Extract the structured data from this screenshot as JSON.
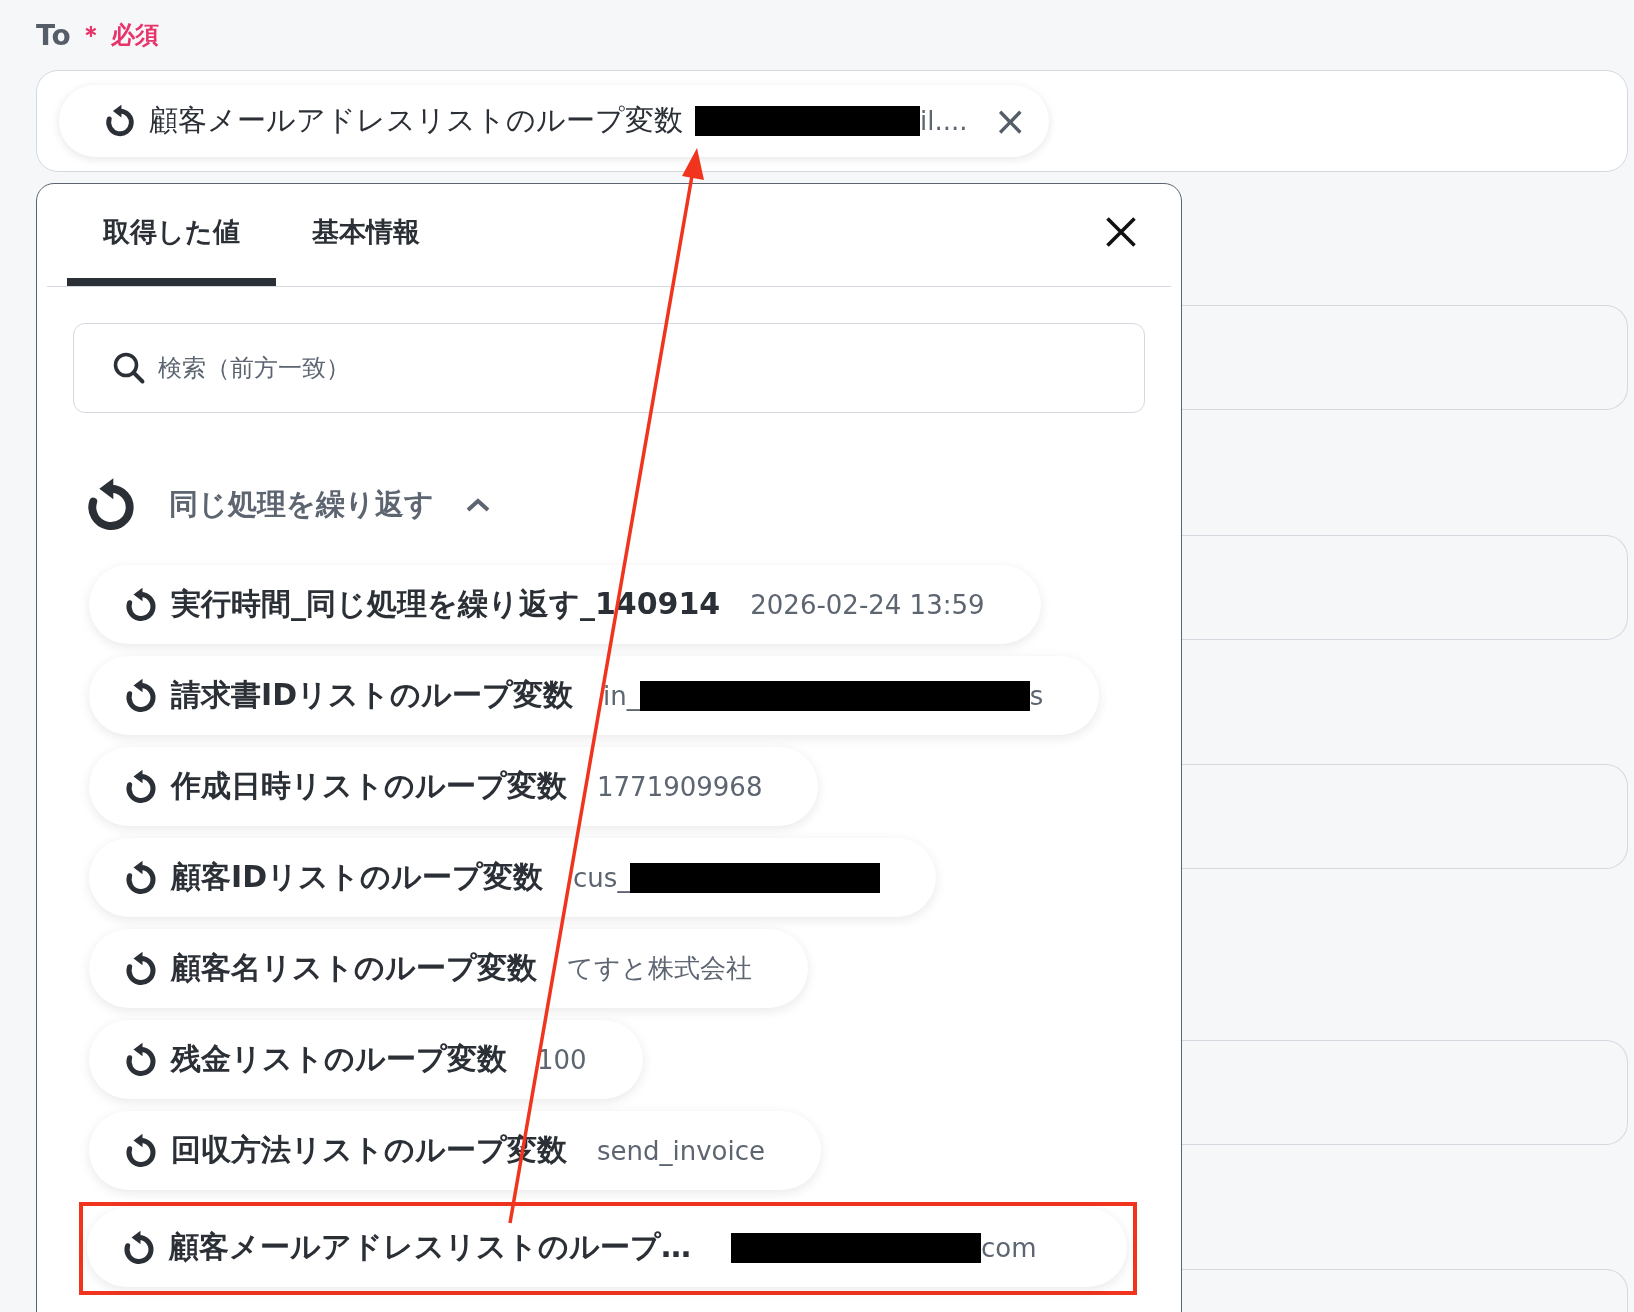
{
  "field": {
    "label": "To",
    "required_mark": "＊",
    "required_text": "必須",
    "chip": {
      "label": "顧客メールアドレスリストのループ変数",
      "redacted": true,
      "value_end": "il....",
      "remove": "×"
    }
  },
  "other_fields": [
    {
      "kind": "empty"
    },
    {
      "kind": "empty"
    },
    {
      "kind": "empty"
    },
    {
      "kind": "empty"
    },
    {
      "kind": "empty"
    }
  ],
  "popup": {
    "tabs": [
      {
        "label": "取得した値",
        "selected": true
      },
      {
        "label": "基本情報",
        "selected": false
      }
    ],
    "search": {
      "placeholder": "検索（前方一致）"
    },
    "group": {
      "title": "同じ処理を繰り返す",
      "expanded": true,
      "items": [
        {
          "label": "実行時間_同じ処理を繰り返す_140914",
          "value": "2026-02-24 13:59",
          "redacted": false,
          "highlighted": false
        },
        {
          "label": "請求書IDリストのループ変数",
          "value": "in_",
          "redacted": true,
          "value_end": "s",
          "highlighted": false
        },
        {
          "label": "作成日時リストのループ変数",
          "value": "1771909968",
          "redacted": false,
          "highlighted": false
        },
        {
          "label": "顧客IDリストのループ変数",
          "value": "cus_",
          "redacted": true,
          "highlighted": false
        },
        {
          "label": "顧客名リストのループ変数",
          "value": "てすと株式会社",
          "redacted": false,
          "highlighted": false
        },
        {
          "label": "残金リストのループ変数",
          "value": "100",
          "redacted": false,
          "highlighted": false
        },
        {
          "label": "回収方法リストのループ変数",
          "value": "send_invoice",
          "redacted": false,
          "highlighted": false
        },
        {
          "label": "顧客メールアドレスリストのループ…",
          "redacted": true,
          "value_end": "com",
          "highlighted": true
        }
      ]
    }
  }
}
